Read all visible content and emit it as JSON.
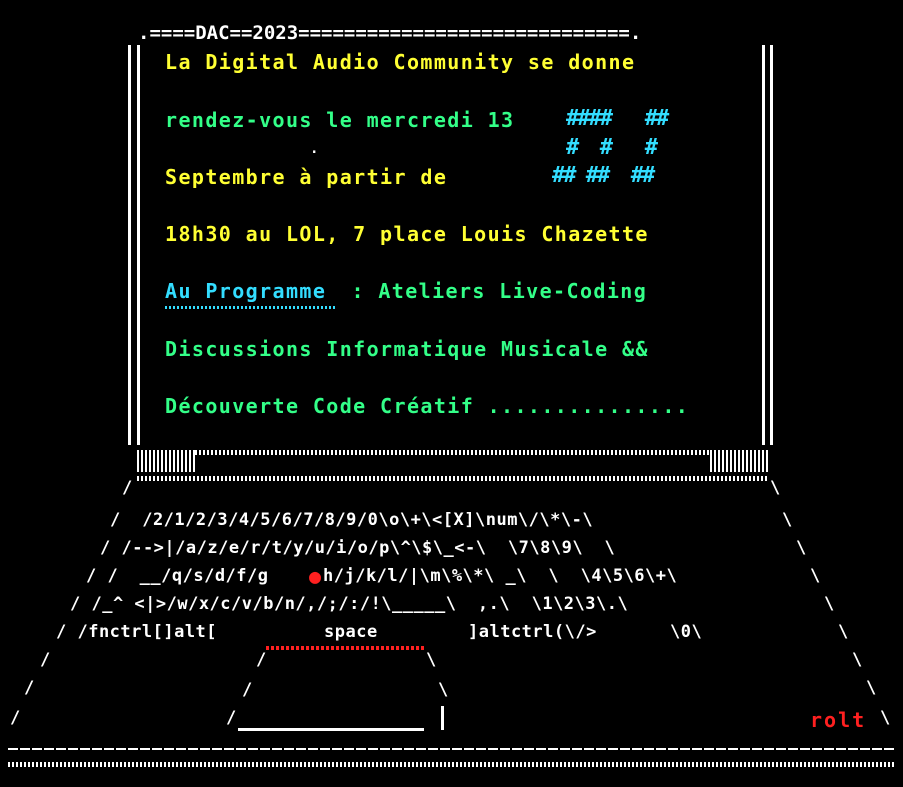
{
  "screen": {
    "title_bar": ".====DAC==2023=============================.",
    "lines": [
      "La Digital Audio Community se donne",
      "rendez-vous le mercredi 13",
      ".",
      "Septembre à partir de",
      "18h30 au LOL, 7 place Louis Chazette",
      "Au Programme",
      " : Ateliers Live-Coding",
      "Discussions Informatique Musicale &&",
      "Découverte Code Créatif ..............."
    ],
    "ascii_art": [
      "####   ##",
      "#  #   #",
      "## ##  ##"
    ]
  },
  "keyboard": {
    "rows": [
      "/  /2/1/2/3/4/5/6/7/8/9/0\\o\\+\\<[X]\\num\\/\\*\\-\\",
      "/ /-->|/a/z/e/r/t/y/u/i/o/p\\^\\$\\_<-\\  \\7\\8\\9\\  \\",
      "/ /  __/q/s/d/f/g",
      "h/j/k/l/|\\m\\%\\*\\ _\\  \\  \\4\\5\\6\\+\\",
      "/ /_^ <|>/w/x/c/v/b/n/,/;/:/!\\_____\\  ,.\\  \\1\\2\\3\\.\\",
      "/ /fnctrl[]alt[",
      "space",
      "]altctrl(\\/>",
      "\\0\\"
    ]
  },
  "corner_label": "rolt",
  "colors": {
    "background": "#000000",
    "text_white": "#ffffff",
    "text_yellow": "#ffff33",
    "text_green": "#33ff88",
    "text_cyan": "#33ddff",
    "accent_red": "#ff2020"
  }
}
